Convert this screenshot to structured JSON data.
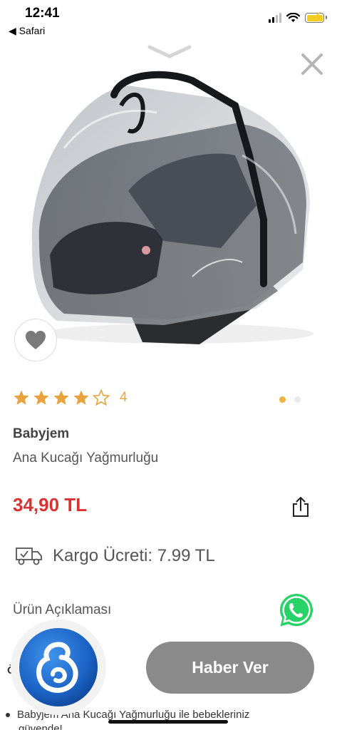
{
  "status_bar": {
    "time": "12:41",
    "back_label": "◀ Safari",
    "icons": [
      "signal-icon",
      "wifi-icon",
      "battery-charging-icon"
    ],
    "battery_color": "#f2cd23"
  },
  "gallery": {
    "page_count": 2,
    "active_page": 1,
    "image_description_icon": "product-photo"
  },
  "product": {
    "rating_stars": 4,
    "rating_max": 5,
    "rating_count": "4",
    "brand": "Babyjem",
    "name": "Ana Kucağı Yağmurluğu",
    "price": "34,90 TL",
    "shipping": "Kargo Ücreti: 7.99 TL"
  },
  "description": {
    "title": "Ürün Açıklaması",
    "section_title_partial": "Öz",
    "bullet_1": "Babyjem Ana Kucağı Yağmurluğu ile bebekleriniz",
    "bullet_2": "güvende!"
  },
  "actions": {
    "notify_label": "Haber Ver"
  },
  "colors": {
    "price": "#d93232",
    "stars": "#e8a33d",
    "notify_button": "#8a8a8a",
    "whatsapp": "#25d366",
    "assistant": "#1e6fd0"
  }
}
